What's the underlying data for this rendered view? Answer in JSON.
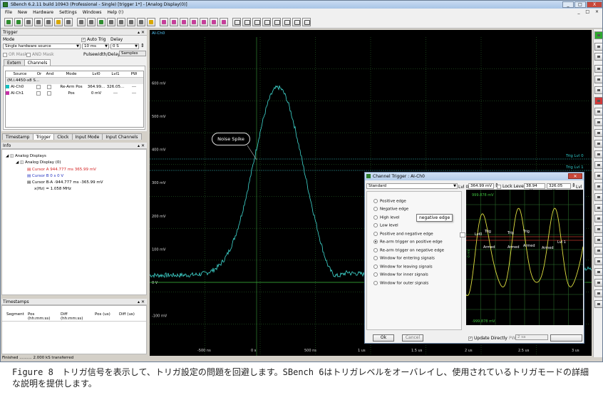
{
  "window": {
    "title": "SBench 6.2.11 build 10943 (Professional - Single)   [trigger 1*] - [Analog Display(0)]",
    "controls": [
      "_",
      "□",
      "X"
    ]
  },
  "menu": [
    "File",
    "New",
    "Hardware",
    "Settings",
    "Windows",
    "Help (!)"
  ],
  "trigger": {
    "header": "Trigger",
    "mode_label": "Mode",
    "mode_value": "Single hardware source",
    "auto_trig_label": "Auto Trig",
    "auto_trig_value": "10 ms",
    "delay_label": "Delay",
    "delay_value": "0 S",
    "or_mask": "OR Mask",
    "and_mask": "AND Mask",
    "pulsewidth_label": "Pulsewidth/Delay in",
    "pulsewidth_value": "Samples",
    "tabs": [
      "Extern",
      "Channels"
    ],
    "columns": [
      "Source",
      "Or",
      "And",
      "Mode",
      "Lvl0",
      "Lvl1",
      "PW"
    ],
    "group_row": "(M.i.4450-x8 S...",
    "rows": [
      {
        "source": "AI-Ch0",
        "mode": "Re-Arm Pos",
        "lvl0": "364.99...",
        "lvl1": "326.05...",
        "pw": "---"
      },
      {
        "source": "AI-Ch1",
        "mode": "Pos",
        "lvl0": "0 mV",
        "lvl1": "---",
        "pw": "---"
      }
    ],
    "colors": {
      "ch0": "#15c0c0",
      "ch1": "#c430a6"
    }
  },
  "panel_tabs": [
    "Timestamp",
    "Trigger",
    "Clock",
    "Input Mode",
    "Input Channels"
  ],
  "info": {
    "header": "Info",
    "lines": [
      "Analog Displays",
      "Analog Display (0)",
      "Cursor A  944.777 ms  365.99 mV",
      "Cursor B  0 s  0 V",
      "Cursor B-A  -944.777 ms  -365.99 mV",
      "x(Hz) = 1.058 MHz"
    ]
  },
  "timestamps": {
    "header": "Timestamps",
    "columns": [
      "Segment",
      "Pos (hh:mm:ss)",
      "Diff (hh:mm:ss)",
      "Pos (us)",
      "Diff (us)"
    ]
  },
  "status": "Finished .......... 2.000 kS transferred",
  "display": {
    "channel_tab": "AI-Ch0",
    "y_ticks": [
      "600 mV",
      "500 mV",
      "400 mV",
      "300 mV",
      "200 mV",
      "100 mV",
      "0 V",
      "-100 mV"
    ],
    "x_ticks": [
      "-500 ns",
      "0 s",
      "500 ns",
      "1 us",
      "1.5 us",
      "2 us",
      "2.5 us",
      "3 us"
    ],
    "trig_labels": [
      "Trig Lvl 0",
      "Trig Lvl 1"
    ],
    "callout": "Noise Spike",
    "trace_color": "#3fd8d0",
    "grid_color": "#2f7a2f"
  },
  "dialog": {
    "title": "Channel Trigger : AI-Ch0",
    "preset": "Standard",
    "lvl0_label": "Lvl 0",
    "lvl0_value": "364.99 mV",
    "lock_label": "Lock Levels",
    "lock_value": "38.94 mV",
    "lvl1_value": "326.05 mV",
    "lvl1_label": "Lvl 1",
    "options": [
      "Positive edge",
      "Negative edge",
      "High level",
      "Low level",
      "Positive and negative edge",
      "Re-arm trigger on positive edge",
      "Re-arm trigger on negative edge",
      "Window for entering signals",
      "Window for leaving signals",
      "Window for inner signals",
      "Window for outer signals"
    ],
    "selected_index": 5,
    "tooltip": "negative edge",
    "graph_top": "999.878 mV",
    "graph_bottom": "-999.878 mV",
    "graph_yaxis": "0 mV",
    "graph_lvl_label": "Lvl 1",
    "graph_annotations": [
      "Lvl0",
      "Trig",
      "Trig",
      "Trig",
      "Armed",
      "Armed",
      "Armed",
      "Armed"
    ],
    "update_label": "Update Directly",
    "pw_label": "PW",
    "pw_value": "2 sa",
    "ok": "Ok",
    "cancel": "Cancel"
  },
  "caption": "Figure 8　トリガ信号を表示して、トリガ設定の問題を回避します。SBench 6はトリガレベルをオーバレイし、使用されているトリガモードの詳細な説明を提供します。"
}
